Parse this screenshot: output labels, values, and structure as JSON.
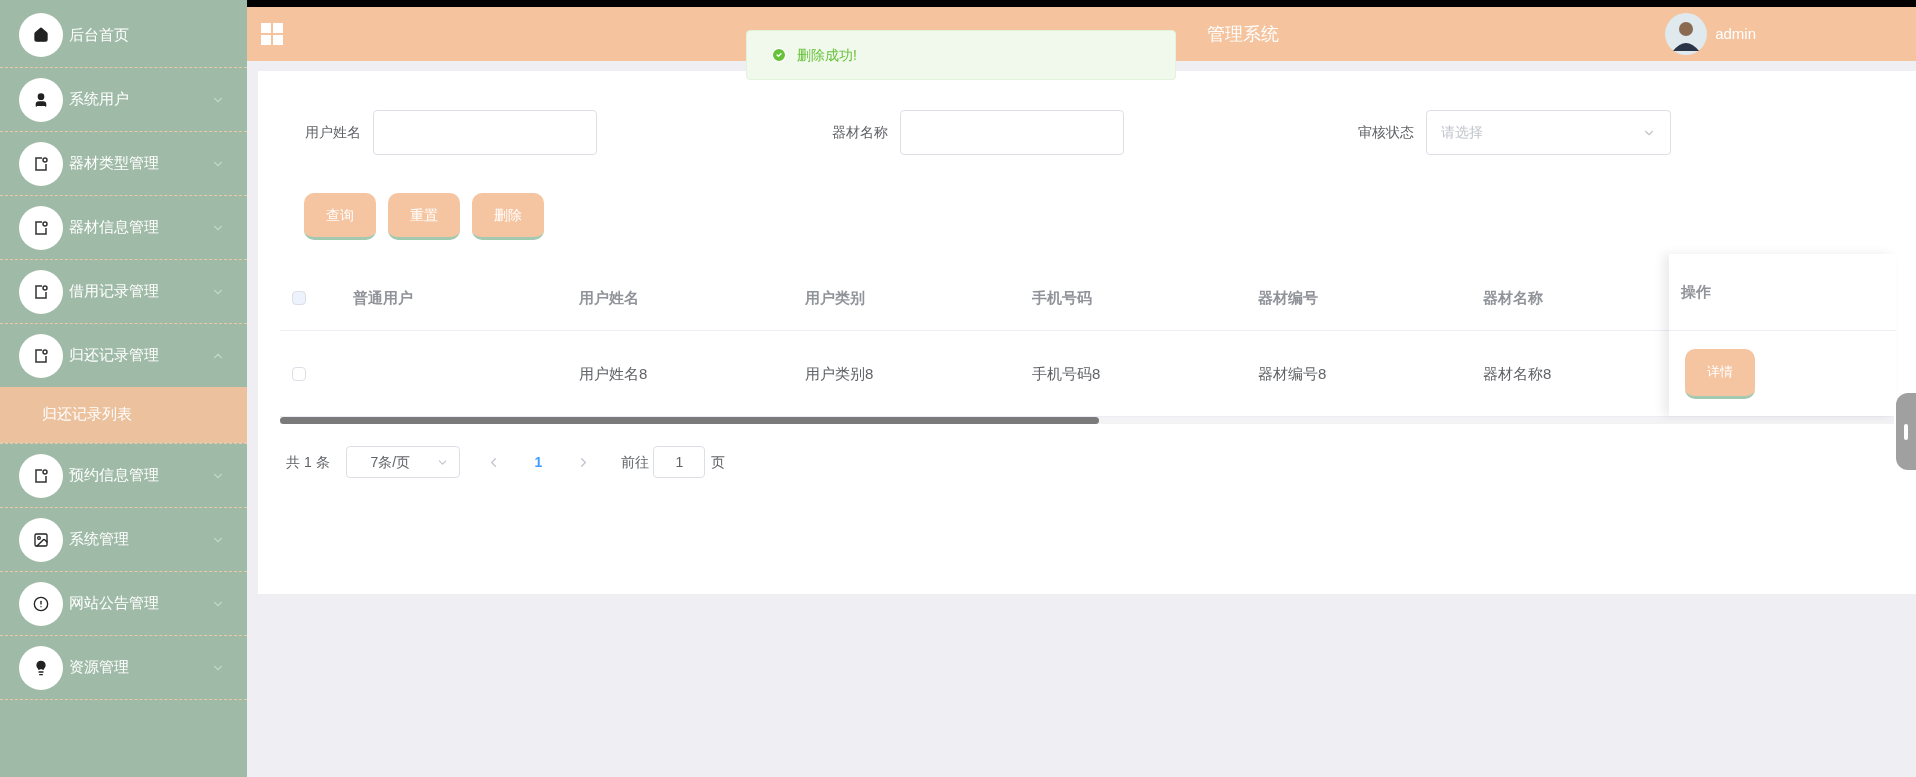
{
  "header": {
    "title": "管理系统",
    "user": "admin"
  },
  "toast": {
    "message": "删除成功!"
  },
  "sidebar": {
    "items": [
      {
        "label": "后台首页",
        "kind": "link"
      },
      {
        "label": "系统用户",
        "kind": "menu",
        "expanded": false
      },
      {
        "label": "器材类型管理",
        "kind": "menu",
        "expanded": false
      },
      {
        "label": "器材信息管理",
        "kind": "menu",
        "expanded": false
      },
      {
        "label": "借用记录管理",
        "kind": "menu",
        "expanded": false
      },
      {
        "label": "归还记录管理",
        "kind": "menu",
        "expanded": true,
        "children": [
          {
            "label": "归还记录列表",
            "selected": true
          }
        ]
      },
      {
        "label": "预约信息管理",
        "kind": "menu",
        "expanded": false
      },
      {
        "label": "系统管理",
        "kind": "menu",
        "expanded": false
      },
      {
        "label": "网站公告管理",
        "kind": "menu",
        "expanded": false
      },
      {
        "label": "资源管理",
        "kind": "menu",
        "expanded": false
      }
    ]
  },
  "search": {
    "fields": [
      {
        "label": "用户姓名",
        "kind": "text"
      },
      {
        "label": "器材名称",
        "kind": "text"
      },
      {
        "label": "审核状态",
        "kind": "select",
        "placeholder": "请选择"
      }
    ],
    "buttons": [
      "查询",
      "重置",
      "删除"
    ]
  },
  "table": {
    "all_checked": false,
    "columns": [
      "普通用户",
      "用户姓名",
      "用户类别",
      "手机号码",
      "器材编号",
      "器材名称"
    ],
    "action_column": "操作",
    "rows": [
      {
        "checked": false,
        "cells": [
          "",
          "用户姓名8",
          "用户类别8",
          "手机号码8",
          "器材编号8",
          "器材名称8"
        ],
        "action": "详情"
      }
    ]
  },
  "pagination": {
    "total": "共 1 条",
    "page_size": "7条/页",
    "pages": [
      {
        "label": "1",
        "selected": true
      }
    ],
    "goto_label": "前往",
    "goto_value": "1",
    "page_suffix": "页"
  }
}
